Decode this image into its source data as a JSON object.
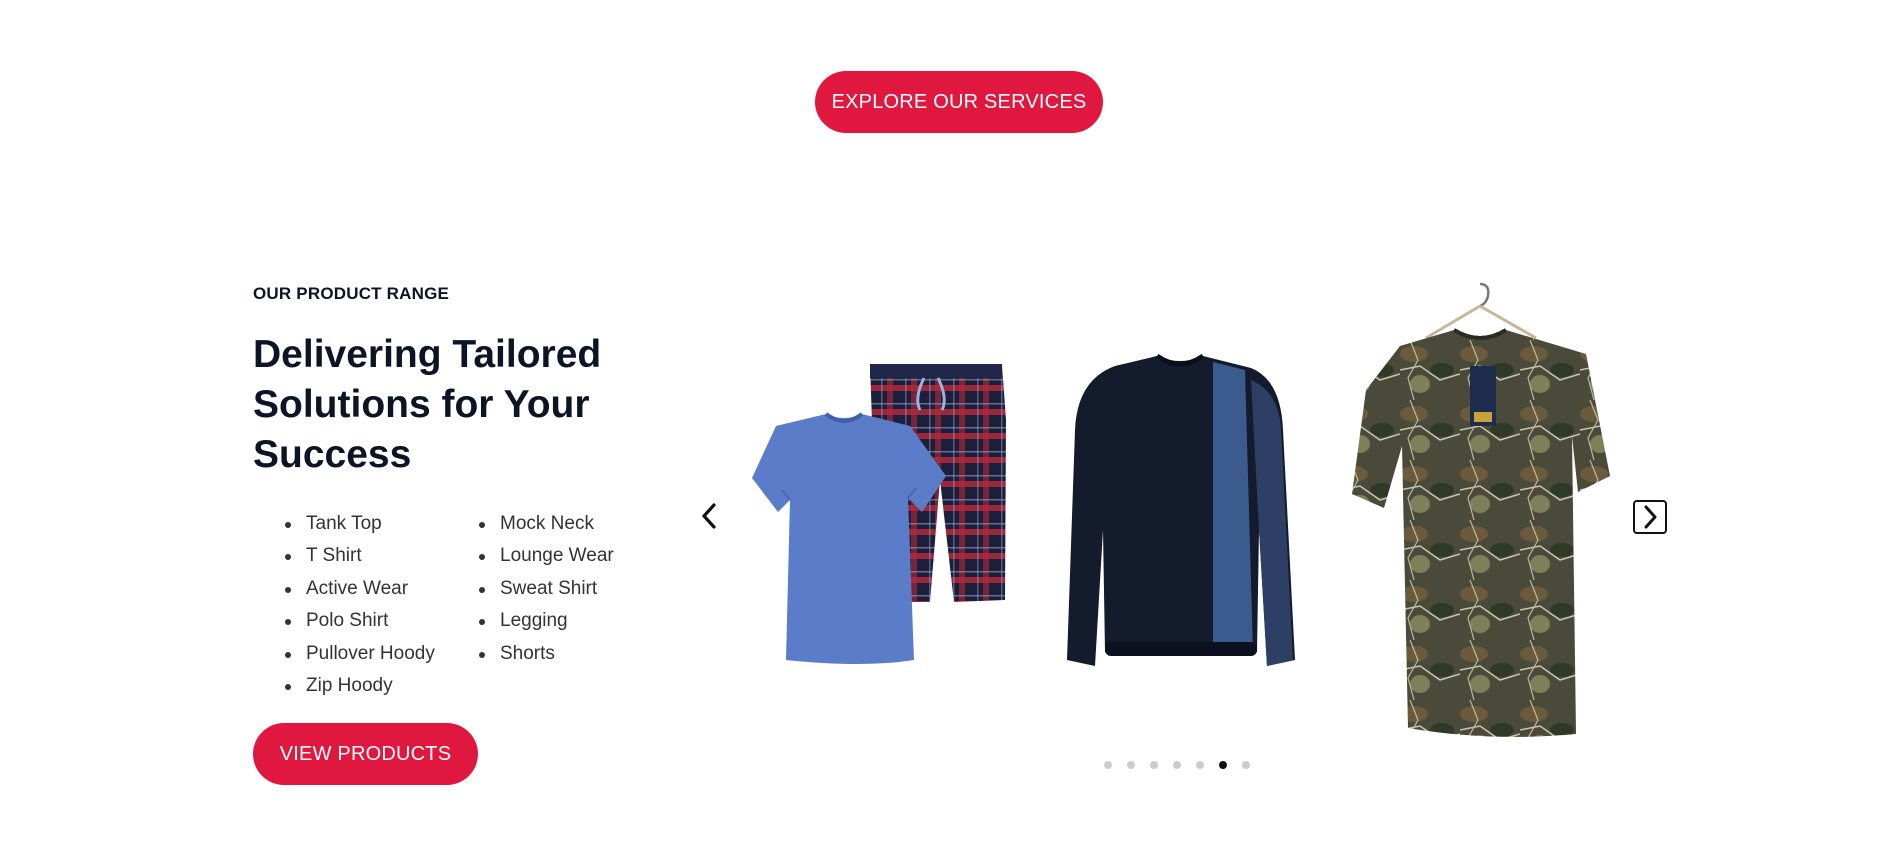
{
  "explore_button": {
    "label": "EXPLORE OUR SERVICES"
  },
  "product_range": {
    "eyebrow": "OUR PRODUCT RANGE",
    "title": "Delivering Tailored Solutions for Your Success",
    "list_left": [
      "Tank Top",
      "T Shirt",
      "Active Wear",
      "Polo Shirt",
      "Pullover Hoody",
      "Zip Hoody"
    ],
    "list_right": [
      "Mock Neck",
      "Lounge Wear",
      "Sweat Shirt",
      "Legging",
      "Shorts"
    ],
    "view_button": {
      "label": "VIEW PRODUCTS"
    }
  },
  "carousel": {
    "slides": [
      "blue-tshirt-plaid-shorts-set",
      "navy-panel-sweatshirt",
      "camo-tshirt-on-hanger"
    ],
    "dot_count": 7,
    "active_dot": 6
  },
  "colors": {
    "accent": "#e0183f",
    "heading": "#0d1426",
    "body_text": "#333333"
  }
}
